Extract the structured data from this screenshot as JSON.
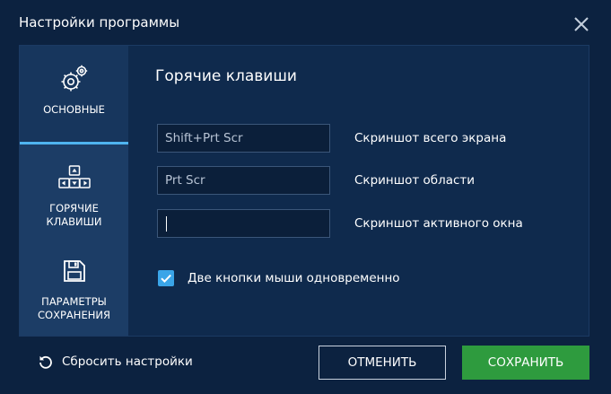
{
  "window": {
    "title": "Настройки программы",
    "close_icon": "close-icon"
  },
  "sidebar": {
    "items": [
      {
        "label": "ОСНОВНЫЕ",
        "icon": "gears-icon",
        "active": true
      },
      {
        "label": "ГОРЯЧИЕ\nКЛАВИШИ",
        "icon": "keyboard-keys-icon",
        "active": false
      },
      {
        "label": "ПАРАМЕТРЫ\nСОХРАНЕНИЯ",
        "icon": "floppy-disk-icon",
        "active": false
      }
    ]
  },
  "content": {
    "title": "Горячие клавиши",
    "hotkeys": [
      {
        "value": "Shift+Prt Scr",
        "label": "Скриншот всего экрана"
      },
      {
        "value": "Prt Scr",
        "label": "Скриншот области"
      },
      {
        "value": "",
        "label": "Скриншот активного окна"
      }
    ],
    "checkbox": {
      "label": "Две кнопки мыши одновременно",
      "checked": true
    }
  },
  "footer": {
    "reset_label": "Сбросить настройки",
    "cancel_label": "ОТМЕНИТЬ",
    "save_label": "СОХРАНИТЬ"
  },
  "colors": {
    "background": "#0c2240",
    "panel": "#0f2a4d",
    "sidebar_tab": "#1c3d66",
    "accent": "#4fb4f0",
    "checkbox": "#3aa5e8",
    "save_button": "#2e9b3e"
  }
}
